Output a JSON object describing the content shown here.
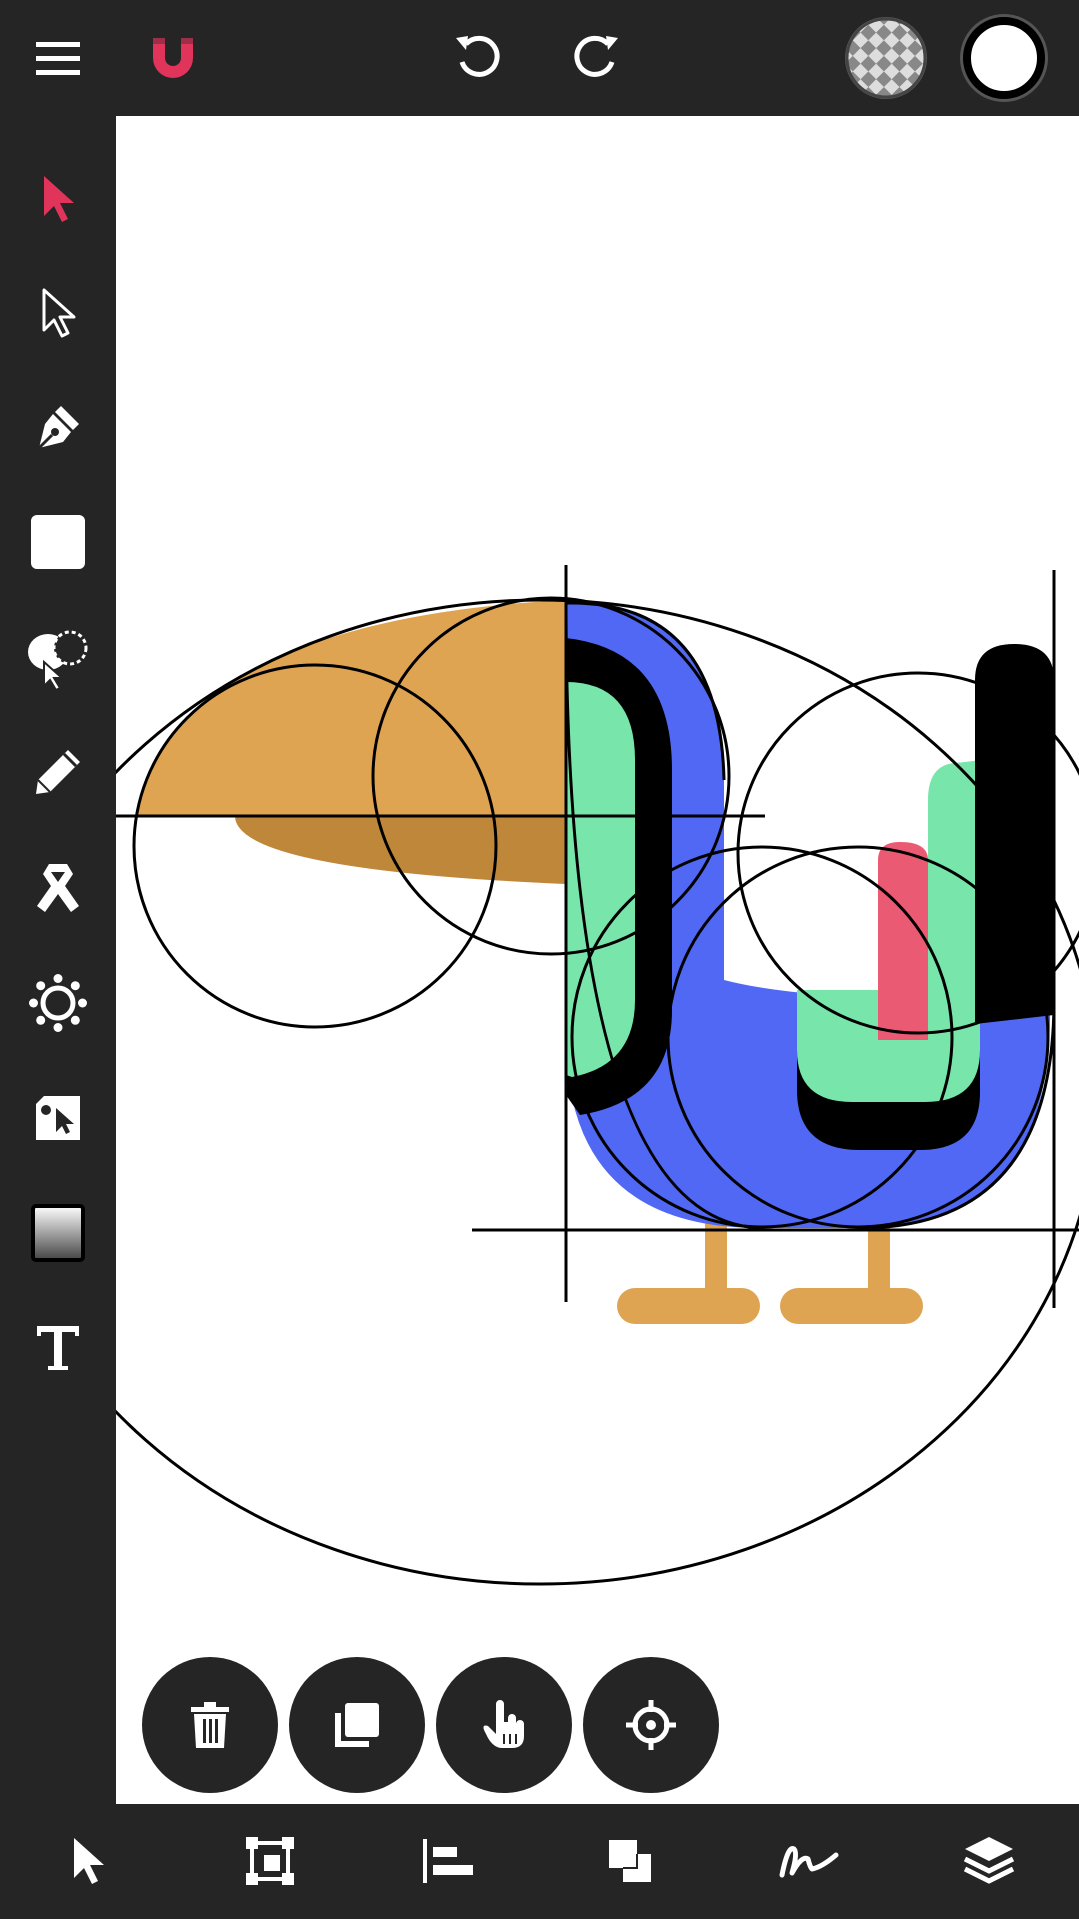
{
  "colors": {
    "chrome": "#252526",
    "accent": "#e0345a",
    "canvas": "#ffffff",
    "orange": "#dfa452",
    "orange_dark": "#bf873a",
    "blue": "#5068f4",
    "green": "#78e5aa",
    "pink": "#eb5a73",
    "black": "#000000"
  },
  "topbar": {
    "menu_icon": "hamburger-menu-icon",
    "logo_icon": "magnet-logo-icon",
    "undo_icon": "undo-icon",
    "redo_icon": "redo-icon",
    "fill_swatch": "checkerboard-fill-swatch",
    "stroke_swatch": "white-stroke-swatch"
  },
  "tools": [
    {
      "icon": "select-arrow-icon",
      "active": true
    },
    {
      "icon": "direct-select-arrow-icon"
    },
    {
      "icon": "pen-nib-icon"
    },
    {
      "icon": "rectangle-icon"
    },
    {
      "icon": "shape-builder-icon"
    },
    {
      "icon": "pencil-icon"
    },
    {
      "icon": "ribbon-icon"
    },
    {
      "icon": "gear-icon"
    },
    {
      "icon": "image-cursor-icon"
    },
    {
      "icon": "gradient-icon"
    },
    {
      "icon": "text-tool-icon"
    }
  ],
  "fabs": [
    {
      "icon": "trash-icon"
    },
    {
      "icon": "duplicate-icon"
    },
    {
      "icon": "hand-pointer-icon"
    },
    {
      "icon": "crosshair-icon"
    }
  ],
  "bottombar": [
    {
      "icon": "select-arrow-icon"
    },
    {
      "icon": "transform-frame-icon"
    },
    {
      "icon": "align-left-icon"
    },
    {
      "icon": "boolean-shapes-icon"
    },
    {
      "icon": "signature-icon"
    },
    {
      "icon": "layers-icon"
    }
  ]
}
